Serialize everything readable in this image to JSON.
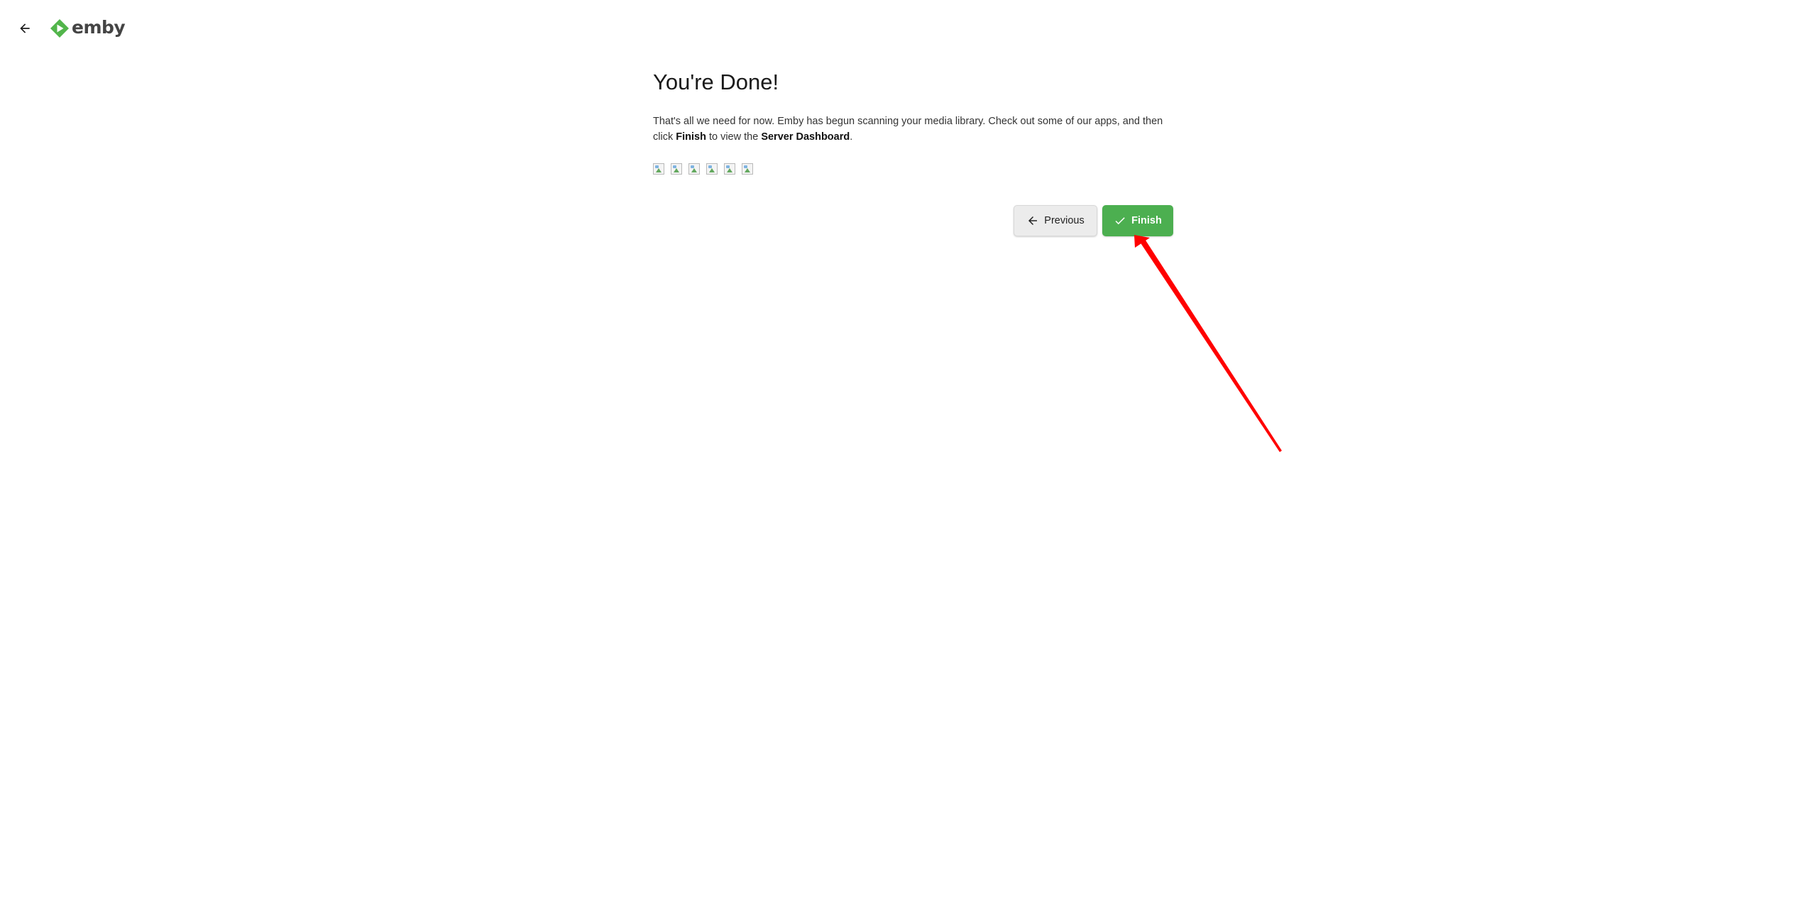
{
  "header": {
    "back_icon": "arrow-left-icon",
    "logo_text": "emby",
    "logo_color": "#52b54b"
  },
  "main": {
    "title": "You're Done!",
    "description": {
      "part1": "That's all we need for now. Emby has begun scanning your media library. Check out some of our apps, and then click ",
      "finish_bold": "Finish",
      "part2": " to view the ",
      "dashboard_bold": "Server Dashboard",
      "part3": "."
    },
    "app_icons": [
      "broken-image-icon",
      "broken-image-icon",
      "broken-image-icon",
      "broken-image-icon",
      "broken-image-icon",
      "broken-image-icon"
    ]
  },
  "buttons": {
    "previous_label": "Previous",
    "previous_icon": "arrow-left-icon",
    "finish_label": "Finish",
    "finish_icon": "check-icon",
    "finish_color": "#4caf50"
  },
  "annotation": {
    "type": "arrow",
    "color": "#ff0000",
    "points_to": "finish-button"
  }
}
